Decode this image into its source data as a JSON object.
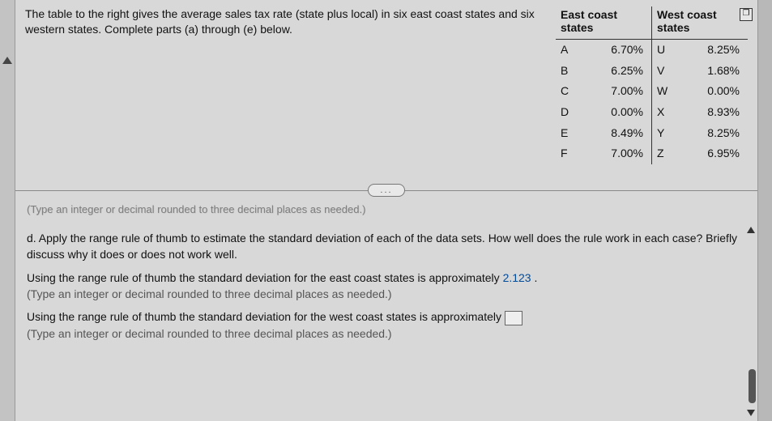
{
  "prompt": "The table to the right gives the average sales tax rate (state plus local) in six east coast states and six western states. Complete parts (a) through (e) below.",
  "table": {
    "east_header": "East coast states",
    "west_header": "West coast states",
    "east": [
      {
        "label": "A",
        "value": "6.70%"
      },
      {
        "label": "B",
        "value": "6.25%"
      },
      {
        "label": "C",
        "value": "7.00%"
      },
      {
        "label": "D",
        "value": "0.00%"
      },
      {
        "label": "E",
        "value": "8.49%"
      },
      {
        "label": "F",
        "value": "7.00%"
      }
    ],
    "west": [
      {
        "label": "U",
        "value": "8.25%"
      },
      {
        "label": "V",
        "value": "1.68%"
      },
      {
        "label": "W",
        "value": "0.00%"
      },
      {
        "label": "X",
        "value": "8.93%"
      },
      {
        "label": "Y",
        "value": "8.25%"
      },
      {
        "label": "Z",
        "value": "6.95%"
      }
    ]
  },
  "separator_btn": "...",
  "ghost_line": "(Type an integer or decimal rounded to three decimal places as needed.)",
  "part_d": {
    "question": "d. Apply the range rule of thumb to estimate the standard deviation of each of the data sets. How well does the rule work in each case? Briefly discuss why it does or does not work well.",
    "east_sentence_pre": "Using the range rule of thumb the standard deviation for the east coast states is approximately ",
    "east_answer": "2.123",
    "east_sentence_post": " .",
    "hint": "(Type an integer or decimal rounded to three decimal places as needed.)",
    "west_sentence_pre": "Using the range rule of thumb the standard deviation for the west coast states is approximately ",
    "west_sentence_post": ""
  },
  "popout_glyph": "❐"
}
